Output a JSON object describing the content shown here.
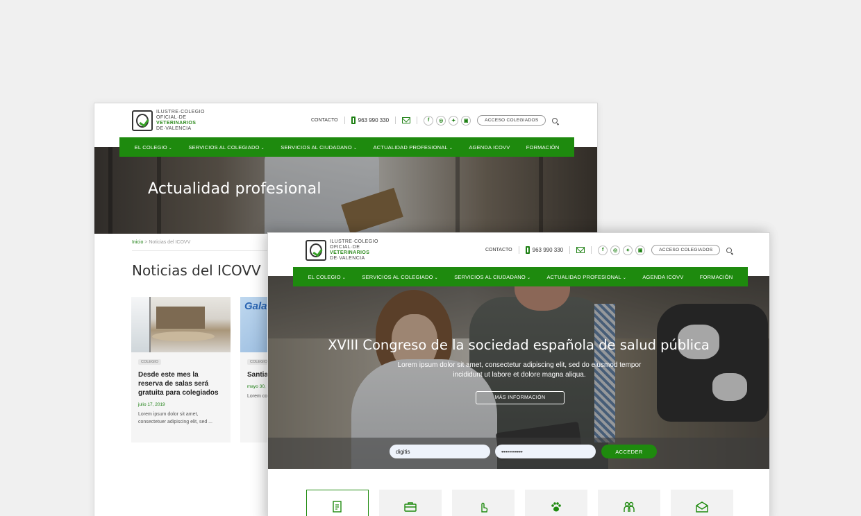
{
  "header": {
    "logo_lines": [
      "ILUSTRE·COLEGIO",
      "OFICIAL·DE",
      "VETERINARIOS",
      "DE·VALENCIA"
    ],
    "contact_label": "CONTACTO",
    "phone": "963 990 330",
    "social": [
      "f",
      "ig",
      "tw",
      "in"
    ],
    "access_label": "ACCESO COLEGIADOS"
  },
  "nav": {
    "items": [
      {
        "label": "EL COLEGIO",
        "dropdown": true
      },
      {
        "label": "SERVICIOS AL COLEGIADO",
        "dropdown": true
      },
      {
        "label": "SERVICIOS AL CIUDADANO",
        "dropdown": true
      },
      {
        "label": "ACTUALIDAD PROFESIONAL",
        "dropdown": true
      },
      {
        "label": "AGENDA ICOVV",
        "dropdown": false
      },
      {
        "label": "FORMACIÓN",
        "dropdown": false
      }
    ],
    "caret": "⌄"
  },
  "back_page": {
    "hero_title": "Actualidad profesional",
    "breadcrumb": {
      "home": "Inicio",
      "sep": ">",
      "current": "Noticias del ICOVV"
    },
    "page_title": "Noticias del ICOVV",
    "cards": [
      {
        "tag": "COLEGIO",
        "title": "Desde este mes la reserva de salas será gratuita para colegiados",
        "date": "julio 17, 2019",
        "excerpt": "Lorem ipsum dolor sit amet, consectetuer adipiscing elit, sed ..."
      },
      {
        "tag": "COLEGIO",
        "image_text": "Gala Alican",
        "title": "Santia vocal e econó",
        "date": "mayo 30,",
        "excerpt": "Lorem consec"
      }
    ]
  },
  "front_page": {
    "hero_title": "XVIII Congreso de la sociedad española de salud pública",
    "hero_desc": "Lorem ipsum dolor sit amet, consectetur adipiscing elit, sed do eiusmod tempor incididunt ut labore et dolore magna aliqua.",
    "hero_button": "MÁS INFORMACIÓN",
    "login": {
      "username": "digitis",
      "password": "•••••••••••",
      "submit": "ACCEDER"
    },
    "tiles": [
      "document-icon",
      "briefcase-icon",
      "hand-pointer-icon",
      "paw-icon",
      "people-icon",
      "mail-open-icon"
    ]
  },
  "colors": {
    "brand_green": "#1e8a0e",
    "text_dark": "#333333"
  }
}
